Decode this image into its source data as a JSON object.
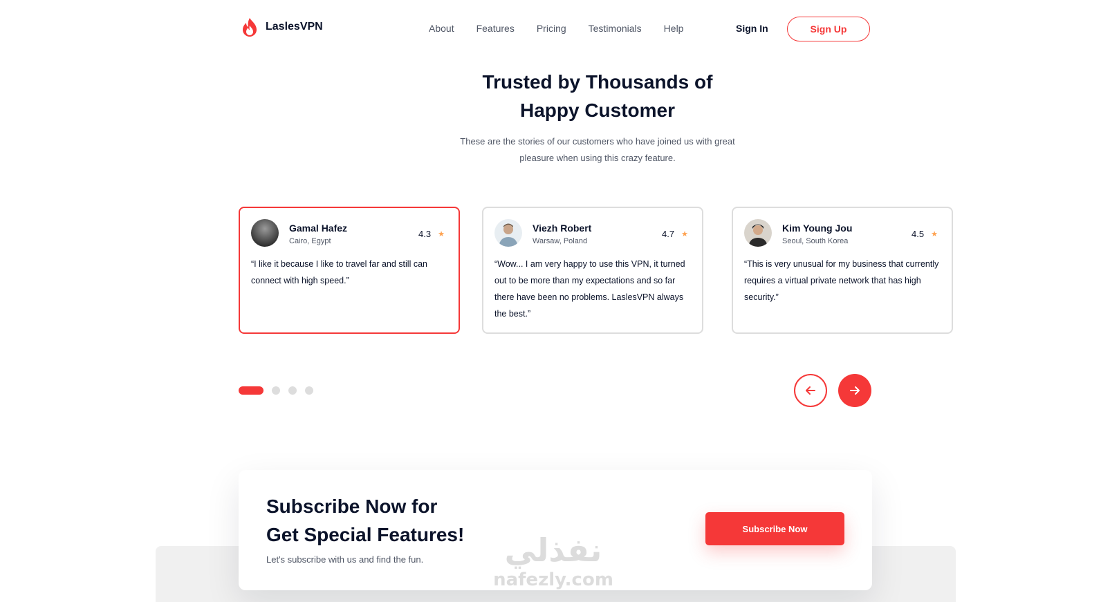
{
  "brand": {
    "name": "LaslesVPN",
    "accent": "#f53838"
  },
  "nav": {
    "items": [
      "About",
      "Features",
      "Pricing",
      "Testimonials",
      "Help"
    ],
    "signin": "Sign In",
    "signup": "Sign Up"
  },
  "hero": {
    "title_line1": "Trusted by Thousands of",
    "title_line2": "Happy Customer",
    "subtitle_line1": "These are the stories of our customers who have joined us with great",
    "subtitle_line2": "pleasure when using this crazy feature."
  },
  "testimonials": [
    {
      "name": "Gamal Hafez",
      "location": "Cairo, Egypt",
      "rating": "4.3",
      "quote": "“I like it because I like to travel far and still can connect with high speed.”",
      "active": true
    },
    {
      "name": "Viezh Robert",
      "location": "Warsaw, Poland",
      "rating": "4.7",
      "quote": "“Wow... I am very happy to use this VPN, it turned out to be more than my expectations and so far there have been no problems. LaslesVPN always the best.”",
      "active": false
    },
    {
      "name": "Kim Young Jou",
      "location": "Seoul, South Korea",
      "rating": "4.5",
      "quote": "“This is very unusual for my business that currently requires a virtual private network that has high security.”",
      "active": false
    }
  ],
  "pager": {
    "pages": 4,
    "current": 1
  },
  "icons": {
    "star": "star-icon",
    "prev": "arrow-left-icon",
    "next": "arrow-right-icon",
    "logo": "flame-logo-icon"
  },
  "subscribe": {
    "title_line1": "Subscribe Now for",
    "title_line2": "Get Special Features!",
    "text": "Let's subscribe with us and find the fun.",
    "button": "Subscribe Now"
  },
  "watermark": {
    "arabic": "نفذلي",
    "latin": "nafezly.com"
  }
}
